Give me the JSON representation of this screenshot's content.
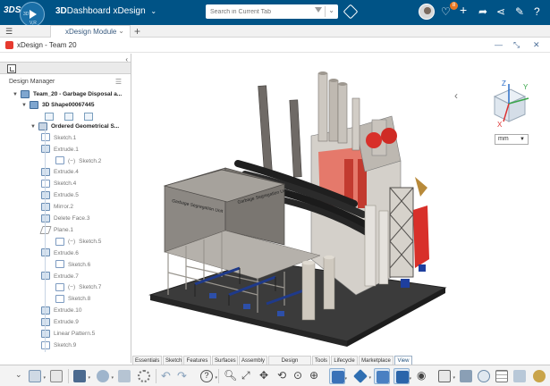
{
  "app": {
    "brand_prefix": "3D",
    "brand_name": "Dashboard",
    "brand_app": "xDesign",
    "compass_labels": [
      "3D",
      "V,R"
    ]
  },
  "search": {
    "placeholder": "Search in Current Tab"
  },
  "notifications": {
    "count": "8"
  },
  "tabs": {
    "active": "xDesign Module",
    "add_label": "+"
  },
  "document": {
    "title": "xDesign - Team 20"
  },
  "left_panel": {
    "header": "Design Manager",
    "tree": [
      {
        "label": "Team_20 - Garbage Disposal a...",
        "level": 0,
        "icon": "asm",
        "strong": true,
        "twisty": "▼"
      },
      {
        "label": "3D Shape00067445",
        "level": 1,
        "icon": "asm",
        "strong": true,
        "twisty": "▼"
      },
      {
        "label": "Ordered Geometrical S...",
        "level": 2,
        "icon": "geo",
        "strong": true,
        "twisty": "▼"
      },
      {
        "label": "Sketch.1",
        "level": 3,
        "icon": "sk"
      },
      {
        "label": "Extrude.1",
        "level": 3,
        "icon": "ex"
      },
      {
        "label": "Sketch.2",
        "level": 4,
        "icon": "sk",
        "prefix": "(−)"
      },
      {
        "label": "Extrude.4",
        "level": 3,
        "icon": "ex"
      },
      {
        "label": "Sketch.4",
        "level": 3,
        "icon": "sk"
      },
      {
        "label": "Extrude.5",
        "level": 3,
        "icon": "ex"
      },
      {
        "label": "Mirror.2",
        "level": 3,
        "icon": "ex"
      },
      {
        "label": "Delete Face.3",
        "level": 3,
        "icon": "ex"
      },
      {
        "label": "Plane.1",
        "level": 3,
        "icon": "pl"
      },
      {
        "label": "Sketch.5",
        "level": 4,
        "icon": "sk",
        "prefix": "(−)"
      },
      {
        "label": "Extrude.6",
        "level": 3,
        "icon": "ex"
      },
      {
        "label": "Sketch.6",
        "level": 4,
        "icon": "sk"
      },
      {
        "label": "Extrude.7",
        "level": 3,
        "icon": "ex"
      },
      {
        "label": "Sketch.7",
        "level": 4,
        "icon": "sk",
        "prefix": "(−)"
      },
      {
        "label": "Sketch.8",
        "level": 4,
        "icon": "sk"
      },
      {
        "label": "Extrude.10",
        "level": 3,
        "icon": "ex"
      },
      {
        "label": "Extrude.9",
        "level": 3,
        "icon": "ex"
      },
      {
        "label": "Linear Pattern.5",
        "level": 3,
        "icon": "ex"
      },
      {
        "label": "Sketch.9",
        "level": 3,
        "icon": "sk"
      }
    ]
  },
  "viewport": {
    "units": "mm",
    "axis_labels": [
      "Z",
      "Y",
      "X"
    ],
    "model_labels": [
      "Garbage Segregation Unit",
      "Garbage Segregation Unit"
    ]
  },
  "ribbon": {
    "tabs": [
      "Essentials",
      "Sketch",
      "Features",
      "Surfaces",
      "Assembly",
      "Design Guidance",
      "Tools",
      "Lifecycle",
      "Marketplace",
      "View"
    ],
    "active_tab": "View"
  },
  "colors": {
    "topbar": "#005386",
    "accent": "#1f4f7b",
    "chimney": "#6e6a66",
    "structure": "#c9c5bf",
    "accent_red": "#d8302a",
    "accent_blue": "#1e3f9e"
  }
}
